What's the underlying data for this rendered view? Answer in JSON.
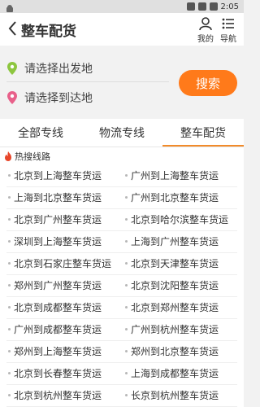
{
  "status": {
    "time": "2:05"
  },
  "header": {
    "title": "整车配货",
    "my_label": "我的",
    "nav_label": "导航"
  },
  "search": {
    "from_placeholder": "请选择出发地",
    "to_placeholder": "请选择到达地",
    "button": "搜索"
  },
  "tabs": [
    {
      "label": "全部专线",
      "active": false
    },
    {
      "label": "物流专线",
      "active": false
    },
    {
      "label": "整车配货",
      "active": true
    }
  ],
  "hot": {
    "label": "热搜线路"
  },
  "routes": [
    [
      "北京到上海整车货运",
      "广州到上海整车货运"
    ],
    [
      "上海到北京整车货运",
      "广州到北京整车货运"
    ],
    [
      "北京到广州整车货运",
      "北京到哈尔滨整车货运"
    ],
    [
      "深圳到上海整车货运",
      "上海到广州整车货运"
    ],
    [
      "北京到石家庄整车货运",
      "北京到天津整车货运"
    ],
    [
      "郑州到广州整车货运",
      "北京到沈阳整车货运"
    ],
    [
      "北京到成都整车货运",
      "北京到郑州整车货运"
    ],
    [
      "广州到成都整车货运",
      "广州到杭州整车货运"
    ],
    [
      "郑州到上海整车货运",
      "郑州到北京整车货运"
    ],
    [
      "北京到长春整车货运",
      "上海到成都整车货运"
    ],
    [
      "北京到杭州整车货运",
      "长京到杭州整车货运"
    ]
  ],
  "colors": {
    "accent": "#ff7a1a",
    "from_pin": "#8dc63f",
    "to_pin": "#e8608a"
  }
}
